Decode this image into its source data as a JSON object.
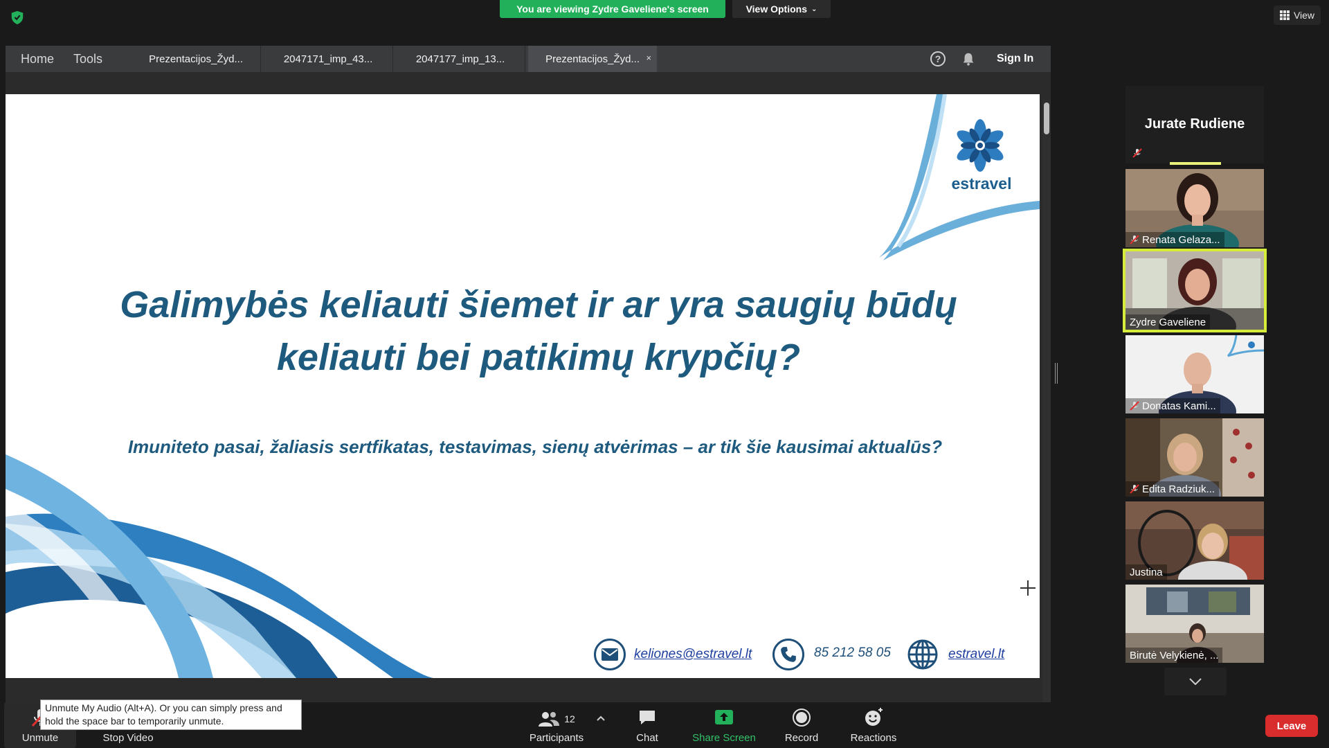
{
  "top_bar": {
    "viewing_banner": "You are viewing Zydre Gaveliene's screen",
    "view_options": "View Options",
    "view_button": "View"
  },
  "shared_app": {
    "nav": [
      "Home",
      "Tools"
    ],
    "tabs": [
      {
        "label": "Prezentacijos_Žyd...",
        "active": false
      },
      {
        "label": "2047171_imp_43...",
        "active": false
      },
      {
        "label": "2047177_imp_13...",
        "active": false
      },
      {
        "label": "Prezentacijos_Žyd...",
        "active": true
      }
    ],
    "tab_close": "×",
    "help_icon": "?",
    "sign_in": "Sign In"
  },
  "slide": {
    "logo_text": "estravel",
    "title_line1": "Galimybės keliauti šiemet ir ar yra saugių būdų",
    "title_line2": "keliauti bei patikimų krypčių?",
    "subtitle": "Imuniteto pasai, žaliasis sertfikatas, testavimas, sienų atvėrimas – ar tik šie kausimai aktualūs?",
    "email": "keliones@estravel.lt",
    "phone": "85 212 58 05",
    "website": "estravel.lt",
    "colors": {
      "title": "#1e5a7e",
      "brand": "#1c5f8f"
    }
  },
  "gallery": {
    "active_speaker": "Jurate Rudiene",
    "tiles": [
      {
        "name": "Renata Gelaza...",
        "muted": true
      },
      {
        "name": "Zydre Gaveliene",
        "muted": false,
        "highlighted": true
      },
      {
        "name": "Donatas Kami...",
        "muted": true
      },
      {
        "name": "Edita Radziuk...",
        "muted": true
      },
      {
        "name": "Justina",
        "muted": false
      },
      {
        "name": "Birutė Velykienė, ...",
        "muted": false
      }
    ]
  },
  "toolbar": {
    "unmute": "Unmute",
    "stop_video": "Stop Video",
    "participants": "Participants",
    "participants_count": "12",
    "chat": "Chat",
    "share_screen": "Share Screen",
    "record": "Record",
    "reactions": "Reactions",
    "leave": "Leave",
    "tooltip": "Unmute My Audio (Alt+A). Or you can simply press and hold the space bar to temporarily unmute."
  }
}
